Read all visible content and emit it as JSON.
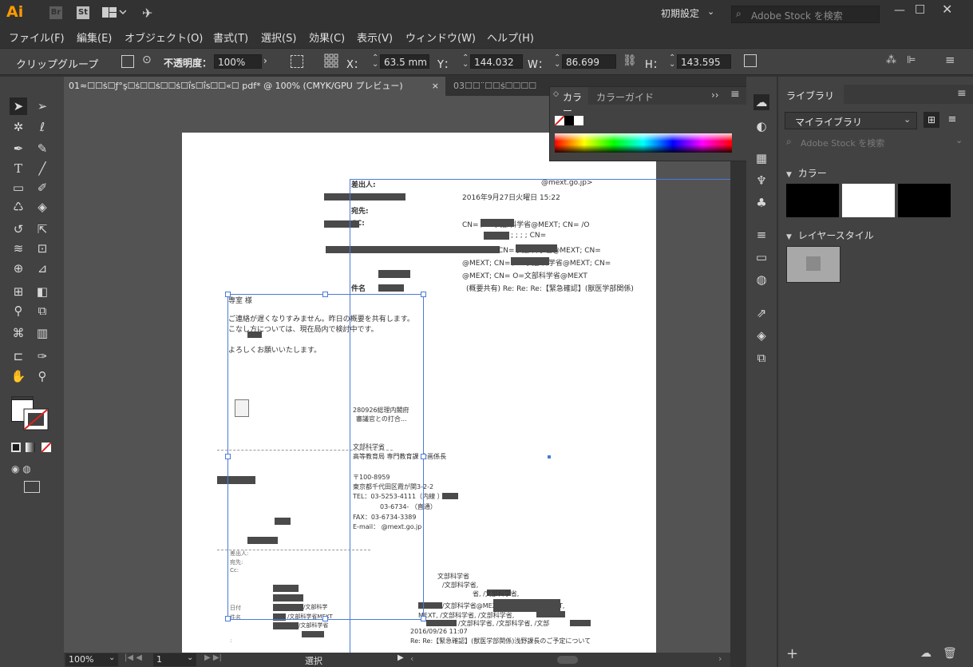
{
  "app": {
    "logo": "Ai",
    "bridge": "Br",
    "stock": "St"
  },
  "titlebar": {
    "workspace": "初期設定",
    "search_placeholder": "Adobe Stock を検索"
  },
  "menu": [
    "ファイル(F)",
    "編集(E)",
    "オブジェクト(O)",
    "書式(T)",
    "選択(S)",
    "効果(C)",
    "表示(V)",
    "ウィンドウ(W)",
    "ヘルプ(H)"
  ],
  "control": {
    "selection_type": "クリップグループ",
    "opacity_label": "不透明度：",
    "opacity_value": "100%",
    "x_label": "X：",
    "x_value": "63.5 mm",
    "y_label": "Y：",
    "y_value": "144.032 mm",
    "w_label": "W：",
    "w_value": "86.699 mm",
    "h_label": "H：",
    "h_value": "143.595 mm"
  },
  "tabs": [
    {
      "label": "01≈☐☐ṡ☐ƒ°ş☐ṡ☐☐ṡ☐☐ṡ☐ḯs☐ḯs☐☐«☐ pdf* @ 100% (CMYK/GPU プレビュー)",
      "close": "×"
    },
    {
      "label": "03☐☐¨☐☐ṡ☐☐☐☐"
    }
  ],
  "color_panel": {
    "tab_color": "カラー",
    "tab_guide": "カラーガイド"
  },
  "library": {
    "title": "ライブラリ",
    "dropdown": "マイライブラリ",
    "search_placeholder": "Adobe Stock を検索",
    "section_color": "カラー",
    "section_layer": "レイヤースタイル"
  },
  "status": {
    "zoom": "100%",
    "page": "1",
    "tool": "選択"
  },
  "document": {
    "from_label": "差出人:",
    "from_value": "@mext.go.jp>",
    "date": "2016年9月27日火曜日 15:22",
    "to_label": "宛先:",
    "cc_label": "CC:",
    "cn1": "CN=        /O=文部科学省@MEXT; CN=          /O",
    "cn2": "CN=         文部科学省@MEXT; CN=",
    "cn3": "@MEXT; CN=          /O=文部科学省@MEXT; CN=",
    "cn4": "@MEXT; CN=           O=文部科学省@MEXT",
    "semicolons": ";             ;            ;              ; CN=",
    "subject_label": "件名",
    "subject_value": "(概要共有) Re: Re: Re:【緊急確認】(獣医学部関係)",
    "salutation": "   専室       様",
    "body1": "ご連絡が遅くなりすみません。昨日の概要を共有します。",
    "body2": "こなし方については、現在局内で検討中です。",
    "body3": "よろしくお願いいたします。",
    "attach1": "280926総理内閣府",
    "attach2": "審議官との打合...",
    "sig1": "文部科学省",
    "sig2": "高等教育局 専門教育課 企画係長",
    "sig3": "〒100-8959",
    "sig4": "東京都千代田区霞が関3-2-2",
    "sig5": "TEL：03-5253-4111（内線     ）",
    "sig6": "03-6734-     （直通）",
    "sig7": "FAX：03-6734-3389",
    "sig8": "E-mail：         @mext.go.jp",
    "q1": "差出人:",
    "q2": "宛先:",
    "q3": "Cc:",
    "q4": "日付",
    "q5": "件名",
    "q6": "/文部科学",
    "q7": "/文部科学省MEXT",
    "q8": "/文部科学省",
    "r1": "文部科学省",
    "r2": "/文部科学省,",
    "r3": "省,       /文部科学省,",
    "r4": "/文部科学省@MEXT,       /文部科学省@MEXT,",
    "r5": "MEXT,        /文部科学省,        /文部科学省,",
    "r6": "/文部科学省,       /文部科学省,        /文部",
    "r7": "2016/09/26 11:07",
    "r8": "Re: Re:【緊急確認】(獣医学部関係)浅野課長のご予定について",
    "e1": "差出人:",
    "e2": "宛先:"
  },
  "colors": {
    "accent": "#4a7bd8",
    "panel": "#424242",
    "bg": "#323232",
    "canvas": "#535353"
  }
}
